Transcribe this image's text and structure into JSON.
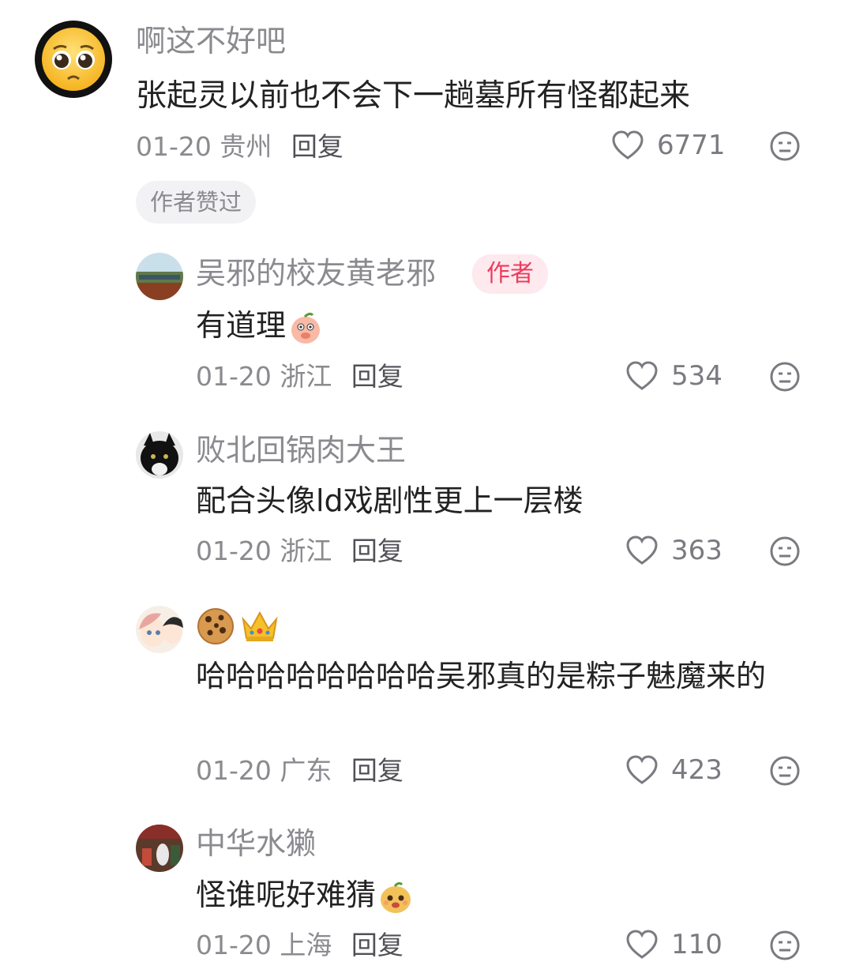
{
  "comments": [
    {
      "username": "啊这不好吧",
      "text": "张起灵以前也不会下一趟墓所有怪都起来",
      "date": "01-20",
      "location": "贵州",
      "reply_label": "回复",
      "likes": "6771",
      "chip": "作者赞过",
      "avatar_icon": "pleading-face-emoji"
    },
    {
      "username": "吴邪的校友黄老邪",
      "badge": "作者",
      "text": "有道理",
      "text_emoji": "peach-covering-mouth-emoji",
      "date": "01-20",
      "location": "浙江",
      "reply_label": "回复",
      "likes": "534",
      "avatar_icon": "rooftop-solar-photo"
    },
    {
      "username": "败北回锅肉大王",
      "text": "配合头像ld戏剧性更上一层楼",
      "date": "01-20",
      "location": "浙江",
      "reply_label": "回复",
      "likes": "363",
      "avatar_icon": "black-cat-photo"
    },
    {
      "username_icons": [
        "cookie-emoji",
        "crown-emoji"
      ],
      "text": "哈哈哈哈哈哈哈哈吴邪真的是粽子魅魔来的",
      "date": "01-20",
      "location": "广东",
      "reply_label": "回复",
      "likes": "423",
      "avatar_icon": "anime-girls-avatar"
    },
    {
      "username": "中华水獭",
      "text": "怪谁呢好难猜",
      "text_emoji": "happy-potato-emoji",
      "date": "01-20",
      "location": "上海",
      "reply_label": "回复",
      "likes": "110",
      "avatar_icon": "market-photo"
    }
  ],
  "colors": {
    "badge_text": "#ee3b5d",
    "badge_bg": "#fde9ee",
    "meta_gray": "#8a8a8f"
  }
}
